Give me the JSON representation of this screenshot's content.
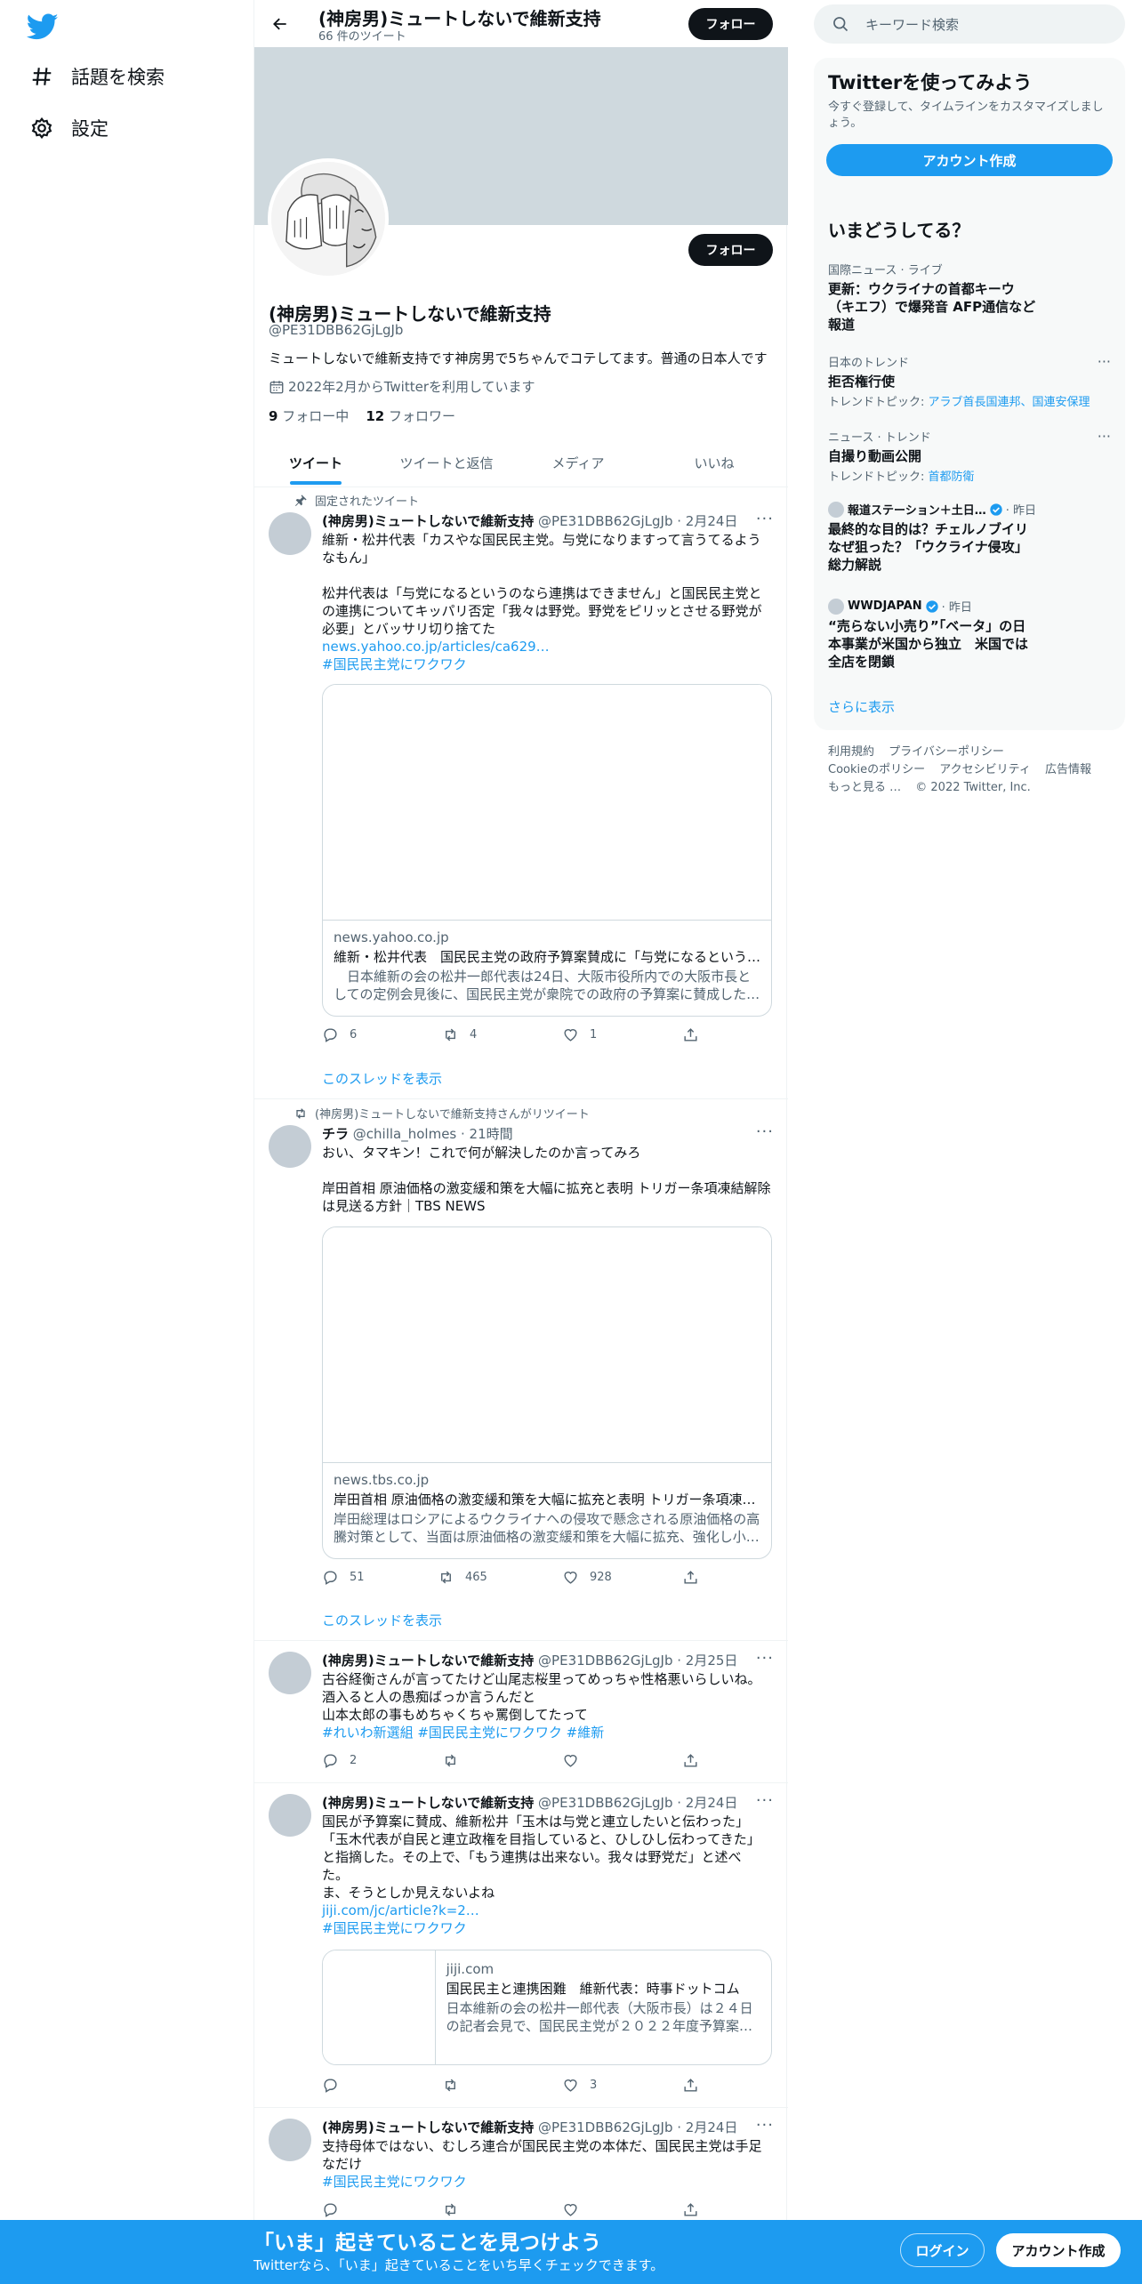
{
  "colors": {
    "accent": "#1d9bf0",
    "text": "#0f1419",
    "muted": "#536471",
    "banner": "#cfd9de"
  },
  "nav": {
    "logo": "twitter-bird-icon",
    "explore_label": "話題を検索",
    "settings_label": "設定"
  },
  "header": {
    "title": "(神房男)ミュートしないで維新支持",
    "tweet_count": "66 件のツイート",
    "follow_label": "フォロー"
  },
  "profile": {
    "name": "(神房男)ミュートしないで維新支持",
    "handle": "@PE31DBB62GjLgJb",
    "bio": "ミュートしないで維新支持です神房男で5ちゃんでコテしてます。普通の日本人です",
    "joined": "2022年2月からTwitterを利用しています",
    "following_count": "9",
    "following_label": "フォロー中",
    "followers_count": "12",
    "followers_label": "フォロワー",
    "follow_label": "フォロー"
  },
  "tabs": [
    "ツイート",
    "ツイートと返信",
    "メディア",
    "いいね"
  ],
  "tweets": [
    {
      "context": "固定されたツイート",
      "name": "(神房男)ミュートしないで維新支持",
      "meta": "@PE31DBB62GjLgJb · 2月24日",
      "text_lines": [
        "維新・松井代表「カスやな国民民主党。与党になりますって言うてるよう",
        "なもん」",
        "",
        "松井代表は「与党になるというのなら連携はできません」と国民民主党と",
        "の連携についてキッパリ否定「我々は野党。野党をピリッとさせる野党が",
        "必要」とバッサリ切り捨てた"
      ],
      "link": "news.yahoo.co.jp/articles/ca629…",
      "hashtags": "#国民民主党にワクワク",
      "card": {
        "domain": "news.yahoo.co.jp",
        "title": "維新・松井代表　国民民主党の政府予算案賛成に「与党になるという…",
        "desc": "　日本維新の会の松井一郎代表は24日、大阪市役所内での大阪市長と\nしての定例会見後に、国民民主党が衆院での政府の予算案に賛成した…"
      },
      "replies": "6",
      "retweets": "4",
      "likes": "1",
      "thread_label": "このスレッドを表示"
    },
    {
      "context": "(神房男)ミュートしないで維新支持さんがリツイート",
      "name": "チラ",
      "meta": "@chilla_holmes · 21時間",
      "text_lines": [
        "おい、タマキン！これで何が解決したのか言ってみろ",
        "",
        "岸田首相 原油価格の激変緩和策を大幅に拡充と表明 トリガー条項凍結解除",
        "は見送る方針｜TBS NEWS"
      ],
      "card": {
        "domain": "news.tbs.co.jp",
        "title": "岸田首相 原油価格の激変緩和策を大幅に拡充と表明 トリガー条項凍…",
        "desc": "岸田総理はロシアによるウクライナへの侵攻で懸念される原油価格の高\n騰対策として、当面は原油価格の激変緩和策を大幅に拡充、強化し小…"
      },
      "replies": "51",
      "retweets": "465",
      "likes": "928",
      "thread_label": "このスレッドを表示"
    },
    {
      "name": "(神房男)ミュートしないで維新支持",
      "meta": "@PE31DBB62GjLgJb · 2月25日",
      "text_lines": [
        "古谷経衡さんが言ってたけど山尾志桜里ってめっちゃ性格悪いらしいね。",
        "酒入ると人の愚痴ばっか言うんだと",
        "山本太郎の事もめちゃくちゃ罵倒してたって"
      ],
      "hashtags": "#れいわ新選組 #国民民主党にワクワク #維新",
      "replies": "2",
      "retweets": "",
      "likes": ""
    },
    {
      "name": "(神房男)ミュートしないで維新支持",
      "meta": "@PE31DBB62GjLgJb · 2月24日",
      "text_lines": [
        "国民が予算案に賛成、維新松井「玉木は与党と連立したいと伝わった」",
        "「玉木代表が自民と連立政権を目指していると、ひしひし伝わってきた」",
        "と指摘した。その上で、「もう連携は出来ない。我々は野党だ」と述べ",
        "た。",
        "ま、そうとしか見えないよね"
      ],
      "link": "jiji.com/jc/article?k=2…",
      "hashtags": "#国民民主党にワクワク",
      "card": {
        "domain": "jiji.com",
        "title": "国民民主と連携困難　維新代表：時事ドットコム",
        "desc": "日本維新の会の松井一郎代表（大阪市長）は２４日\nの記者会見で、国民民主党が２０２２年度予算案…"
      },
      "replies": "",
      "retweets": "",
      "likes": "3"
    },
    {
      "name": "(神房男)ミュートしないで維新支持",
      "meta": "@PE31DBB62GjLgJb · 2月24日",
      "text_lines": [
        "支持母体ではない、むしろ連合が国民民主党の本体だ、国民民主党は手足",
        "なだけ"
      ],
      "hashtags": "#国民民主党にワクワク"
    }
  ],
  "search": {
    "placeholder": "キーワード検索"
  },
  "signup_panel": {
    "title": "Twitterを使ってみよう",
    "subtitle": "今すぐ登録して、タイムラインをカスタマイズしましょう。",
    "button": "アカウント作成"
  },
  "trends_panel": {
    "title": "いまどうしてる？",
    "trends": [
      {
        "context": "国際ニュース · ライブ",
        "title_lines": [
          "更新：ウクライナの首都キーウ",
          "（キエフ）で爆発音 AFP通信など",
          "報道"
        ]
      },
      {
        "context": "日本のトレンド",
        "title_lines": [
          "拒否権行使"
        ],
        "topic_prefix": "トレンドトピック: ",
        "topics": "アラブ首長国連邦、国連安保理"
      },
      {
        "context": "ニュース · トレンド",
        "title_lines": [
          "自撮り動画公開"
        ],
        "topic_prefix": "トレンドトピック: ",
        "topics": "首都防衛"
      },
      {
        "source": "報道ステーション＋土日…",
        "time": "· 昨日",
        "title_lines": [
          "最終的な目的は？チェルノブイリ",
          "なぜ狙った？「ウクライナ侵攻」",
          "総力解説"
        ]
      },
      {
        "source": "WWDJAPAN",
        "time": "· 昨日",
        "title_lines": [
          "“売らない小売り”「ベータ」の日",
          "本事業が米国から独立　米国では",
          "全店を閉鎖"
        ]
      }
    ],
    "show_more": "さらに表示"
  },
  "footer": {
    "links": [
      "利用規約",
      "プライバシーポリシー",
      "Cookieのポリシー",
      "アクセシビリティ",
      "広告情報",
      "もっと見る …",
      "© 2022 Twitter, Inc."
    ]
  },
  "bottom_bar": {
    "title": "「いま」起きていることを見つけよう",
    "subtitle": "Twitterなら、「いま」起きていることをいち早くチェックできます。",
    "login": "ログイン",
    "signup": "アカウント作成"
  }
}
